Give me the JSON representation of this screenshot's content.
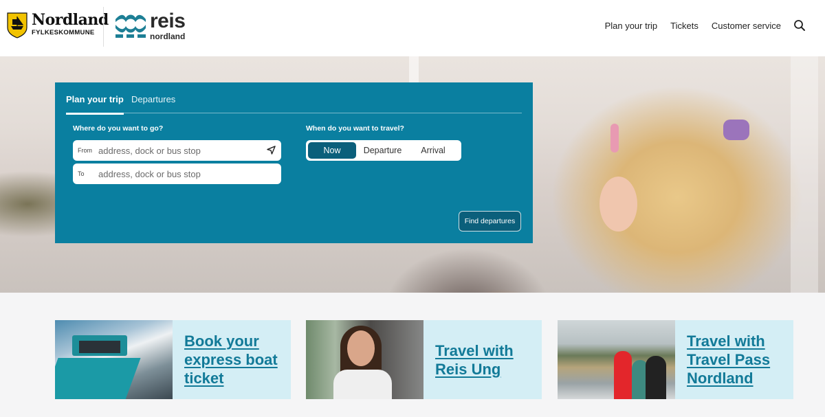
{
  "header": {
    "logo_primary": {
      "name": "Nordland",
      "subtitle": "FYLKESKOMMUNE"
    },
    "logo_secondary": {
      "name": "reis",
      "subtitle": "nordland"
    },
    "nav": [
      {
        "label": "Plan your trip"
      },
      {
        "label": "Tickets"
      },
      {
        "label": "Customer service"
      }
    ],
    "search_icon": "search-icon"
  },
  "planner": {
    "tabs": [
      {
        "label": "Plan your trip",
        "active": true
      },
      {
        "label": "Departures",
        "active": false
      }
    ],
    "where_label": "Where do you want to go?",
    "from": {
      "label": "From",
      "value": "",
      "placeholder": "address, dock or bus stop",
      "icon": "location-arrow-icon"
    },
    "to": {
      "label": "To",
      "value": "",
      "placeholder": "address, dock or bus stop"
    },
    "when_label": "When do you want to travel?",
    "time_options": [
      {
        "label": "Now",
        "selected": true
      },
      {
        "label": "Departure",
        "selected": false
      },
      {
        "label": "Arrival",
        "selected": false
      }
    ],
    "submit_label": "Find departures"
  },
  "cards": [
    {
      "title": "Book your express boat ticket",
      "image": "express boat deck"
    },
    {
      "title": "Travel with Reis Ung",
      "image": "young woman on bus"
    },
    {
      "title": "Travel with Travel Pass Nordland",
      "image": "people on ferry deck with mountain"
    }
  ],
  "colors": {
    "brand_teal": "#0a7fa0",
    "selected_dark": "#0b5f7b",
    "card_bg": "#d4eef5",
    "link": "#127a98"
  }
}
